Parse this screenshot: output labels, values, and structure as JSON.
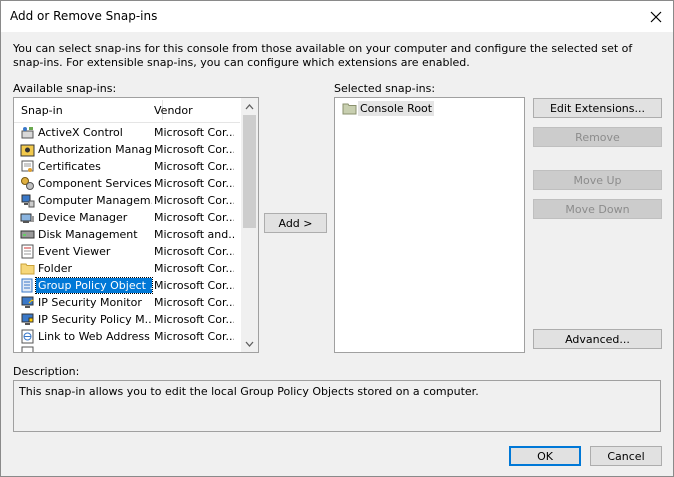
{
  "window": {
    "title": "Add or Remove Snap-ins"
  },
  "intro": "You can select snap-ins for this console from those available on your computer and configure the selected set of snap-ins. For extensible snap-ins, you can configure which extensions are enabled.",
  "available": {
    "label": "Available snap-ins:",
    "columns": {
      "snapin": "Snap-in",
      "vendor": "Vendor"
    },
    "items": [
      {
        "name": "ActiveX Control",
        "vendor": "Microsoft Cor...",
        "icon": "activex-icon"
      },
      {
        "name": "Authorization Manager",
        "vendor": "Microsoft Cor...",
        "icon": "authorization-icon"
      },
      {
        "name": "Certificates",
        "vendor": "Microsoft Cor...",
        "icon": "certificate-icon"
      },
      {
        "name": "Component Services",
        "vendor": "Microsoft Cor...",
        "icon": "component-services-icon"
      },
      {
        "name": "Computer Managem...",
        "vendor": "Microsoft Cor...",
        "icon": "computer-management-icon"
      },
      {
        "name": "Device Manager",
        "vendor": "Microsoft Cor...",
        "icon": "device-manager-icon"
      },
      {
        "name": "Disk Management",
        "vendor": "Microsoft and...",
        "icon": "disk-icon"
      },
      {
        "name": "Event Viewer",
        "vendor": "Microsoft Cor...",
        "icon": "event-viewer-icon"
      },
      {
        "name": "Folder",
        "vendor": "Microsoft Cor...",
        "icon": "folder-icon"
      },
      {
        "name": "Group Policy Object ...",
        "vendor": "Microsoft Cor...",
        "icon": "group-policy-icon"
      },
      {
        "name": "IP Security Monitor",
        "vendor": "Microsoft Cor...",
        "icon": "ip-security-monitor-icon"
      },
      {
        "name": "IP Security Policy M...",
        "vendor": "Microsoft Cor...",
        "icon": "ip-security-policy-icon"
      },
      {
        "name": "Link to Web Address",
        "vendor": "Microsoft Cor...",
        "icon": "web-link-icon"
      }
    ]
  },
  "selected": {
    "label": "Selected snap-ins:",
    "items": [
      {
        "name": "Console Root",
        "icon": "folder-icon"
      }
    ]
  },
  "buttons": {
    "add": "Add >",
    "edit_extensions": "Edit Extensions...",
    "remove": "Remove",
    "move_up": "Move Up",
    "move_down": "Move Down",
    "advanced": "Advanced...",
    "ok": "OK",
    "cancel": "Cancel"
  },
  "description": {
    "label": "Description:",
    "text": "This snap-in allows you to edit the local Group Policy Objects stored on a computer."
  },
  "colors": {
    "selection": "#0078d7",
    "dialog_bg": "#f0f0f0"
  }
}
